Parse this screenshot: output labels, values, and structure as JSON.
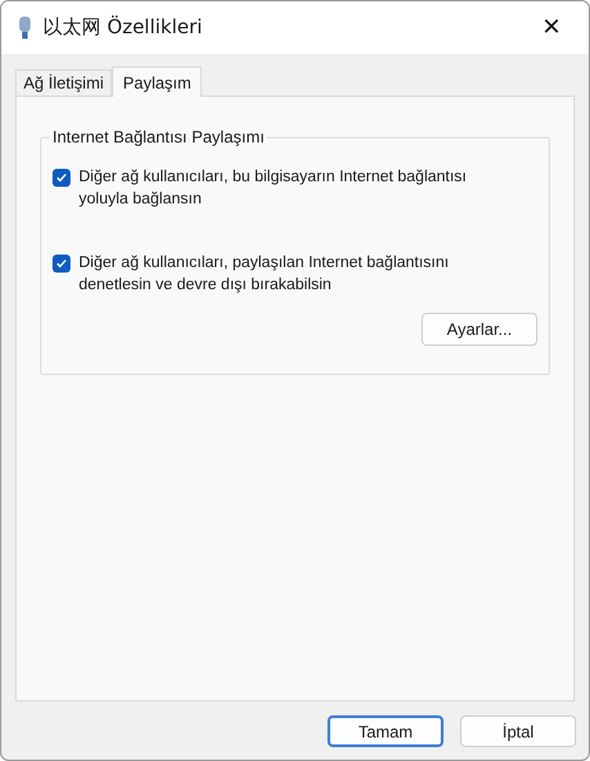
{
  "window": {
    "title": "以太网 Özellikleri",
    "close": "✕"
  },
  "tabs": [
    {
      "label": "Ağ İletişimi",
      "selected": false
    },
    {
      "label": "Paylaşım",
      "selected": true
    }
  ],
  "group": {
    "title": "Internet Bağlantısı Paylaşımı",
    "options": [
      {
        "label": "Diğer ağ kullanıcıları, bu bilgisayarın Internet bağlantısı yoluyla bağlansın",
        "checked": true
      },
      {
        "label": "Diğer ağ kullanıcıları, paylaşılan Internet bağlantısını denetlesin ve devre dışı bırakabilsin",
        "checked": true
      }
    ],
    "settings_button": "Ayarlar..."
  },
  "buttons": [
    {
      "label": "Tamam",
      "default": true
    },
    {
      "label": "İptal",
      "default": false
    }
  ]
}
